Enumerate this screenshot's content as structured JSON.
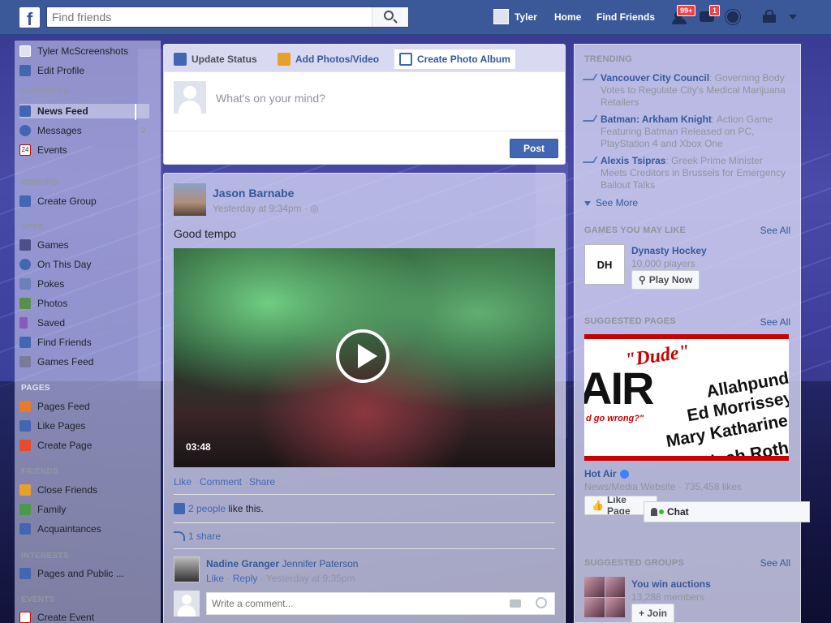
{
  "topbar": {
    "logo": "f",
    "search_placeholder": "Find friends",
    "user_name": "Tyler",
    "home": "Home",
    "find_friends": "Find Friends",
    "friend_requests_badge": "99+",
    "messages_badge": "1"
  },
  "leftnav": {
    "profile_name": "Tyler McScreenshots",
    "edit_profile": "Edit Profile",
    "favorites_head": "FAVORITES",
    "news_feed": "News Feed",
    "messages": "Messages",
    "messages_count": "2",
    "events": "Events",
    "events_icon": "24",
    "groups_head": "GROUPS",
    "create_group": "Create Group",
    "apps_head": "APPS",
    "games": "Games",
    "on_this_day": "On This Day",
    "pokes": "Pokes",
    "photos": "Photos",
    "saved": "Saved",
    "find_friends": "Find Friends",
    "games_feed": "Games Feed",
    "pages_head": "PAGES",
    "pages_feed": "Pages Feed",
    "like_pages": "Like Pages",
    "create_page": "Create Page",
    "friends_head": "FRIENDS",
    "close_friends": "Close Friends",
    "family": "Family",
    "acquaintances": "Acquaintances",
    "interests_head": "INTERESTS",
    "pages_public": "Pages and Public ...",
    "events_head": "EVENTS",
    "create_event": "Create Event"
  },
  "composer": {
    "tab_status": "Update Status",
    "tab_photos": "Add Photos/Video",
    "tab_album": "Create Photo Album",
    "placeholder": "What's on your mind?",
    "post_button": "Post"
  },
  "post": {
    "author": "Jason Barnabe",
    "time": "Yesterday at 9:34pm · ◎",
    "text": "Good tempo",
    "video_duration": "03:48",
    "like": "Like",
    "comment": "Comment",
    "share": "Share",
    "likes_link": "2 people",
    "likes_suffix": " like this.",
    "shares": "1 share",
    "comment_author": "Nadine Granger",
    "comment_mention": "Jennifer Paterson",
    "comment_like": "Like",
    "comment_reply": "Reply",
    "comment_time": "Yesterday at 9:35pm",
    "comment_placeholder": "Write a comment..."
  },
  "right": {
    "trending_head": "TRENDING",
    "trends": [
      {
        "topic": "Vancouver City Council",
        "desc": ": Governing Body Votes to Regulate City's Medical Marijuana Retailers"
      },
      {
        "topic": "Batman: Arkham Knight",
        "desc": ": Action Game Featuring Batman Released on PC, PlayStation 4 and Xbox One"
      },
      {
        "topic": "Alexis Tsipras",
        "desc": ": Greek Prime Minister Meets Creditors in Brussels for Emergency Bailout Talks"
      }
    ],
    "see_more": "See More",
    "games_head": "GAMES YOU MAY LIKE",
    "see_all": "See All",
    "game_logo": "DH",
    "game_title": "Dynasty Hockey",
    "game_players": "10,000 players",
    "play_now": "Play Now",
    "pages_head": "SUGGESTED PAGES",
    "ad_air": "AIR",
    "ad_dude": "\"Dude\"",
    "ad_tag": "d go wrong?\"",
    "ad_names": [
      "Allahpundit",
      "Ed Morrissey",
      "Mary Katharine",
      "Noah Rothman"
    ],
    "page_name": "Hot Air",
    "page_sub": "News/Media Website · 735,458 likes",
    "like_page": "Like Page",
    "groups_head": "SUGGESTED GROUPS",
    "group_title": "You win auctions",
    "group_members": "13,288 members",
    "join": "+ Join"
  },
  "chat": {
    "label": "Chat"
  }
}
